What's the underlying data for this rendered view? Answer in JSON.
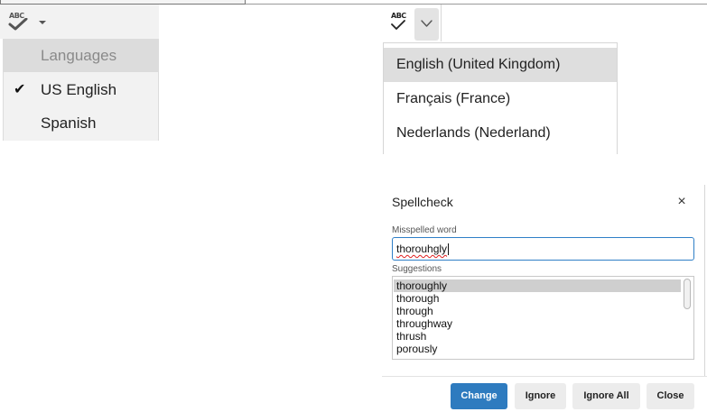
{
  "legacy_toolbar": {
    "spellcheck_icon": "abc-check-icon",
    "spellcheck_icon_text": "ABC",
    "dropdown_icon": "caret-down-icon",
    "menu": {
      "header": "Languages",
      "items": [
        {
          "label": "US English",
          "checked": true
        },
        {
          "label": "Spanish",
          "checked": false
        }
      ],
      "check_glyph": "✔"
    }
  },
  "modern_toolbar": {
    "spellcheck_icon": "abc-check-icon",
    "spellcheck_icon_text": "ABC",
    "dropdown_icon": "chevron-down-icon",
    "menu": {
      "items": [
        {
          "label": "English (United Kingdom)",
          "highlighted": true
        },
        {
          "label": "Français (France)",
          "highlighted": false
        },
        {
          "label": "Nederlands (Nederland)",
          "highlighted": false
        }
      ]
    }
  },
  "dialog": {
    "title": "Spellcheck",
    "close_glyph": "×",
    "misspelled_label": "Misspelled word",
    "misspelled_value": "thorouhgly",
    "suggestions_label": "Suggestions",
    "suggestions": [
      "thoroughly",
      "thorough",
      "through",
      "throughway",
      "thrush",
      "porously"
    ],
    "selected_suggestion": "thoroughly",
    "buttons": {
      "change": "Change",
      "ignore": "Ignore",
      "ignore_all": "Ignore All",
      "close": "Close"
    },
    "colors": {
      "primary": "#2e7bbf",
      "focus_border": "#2f7fc7",
      "spelling_underline": "#e02020"
    }
  }
}
